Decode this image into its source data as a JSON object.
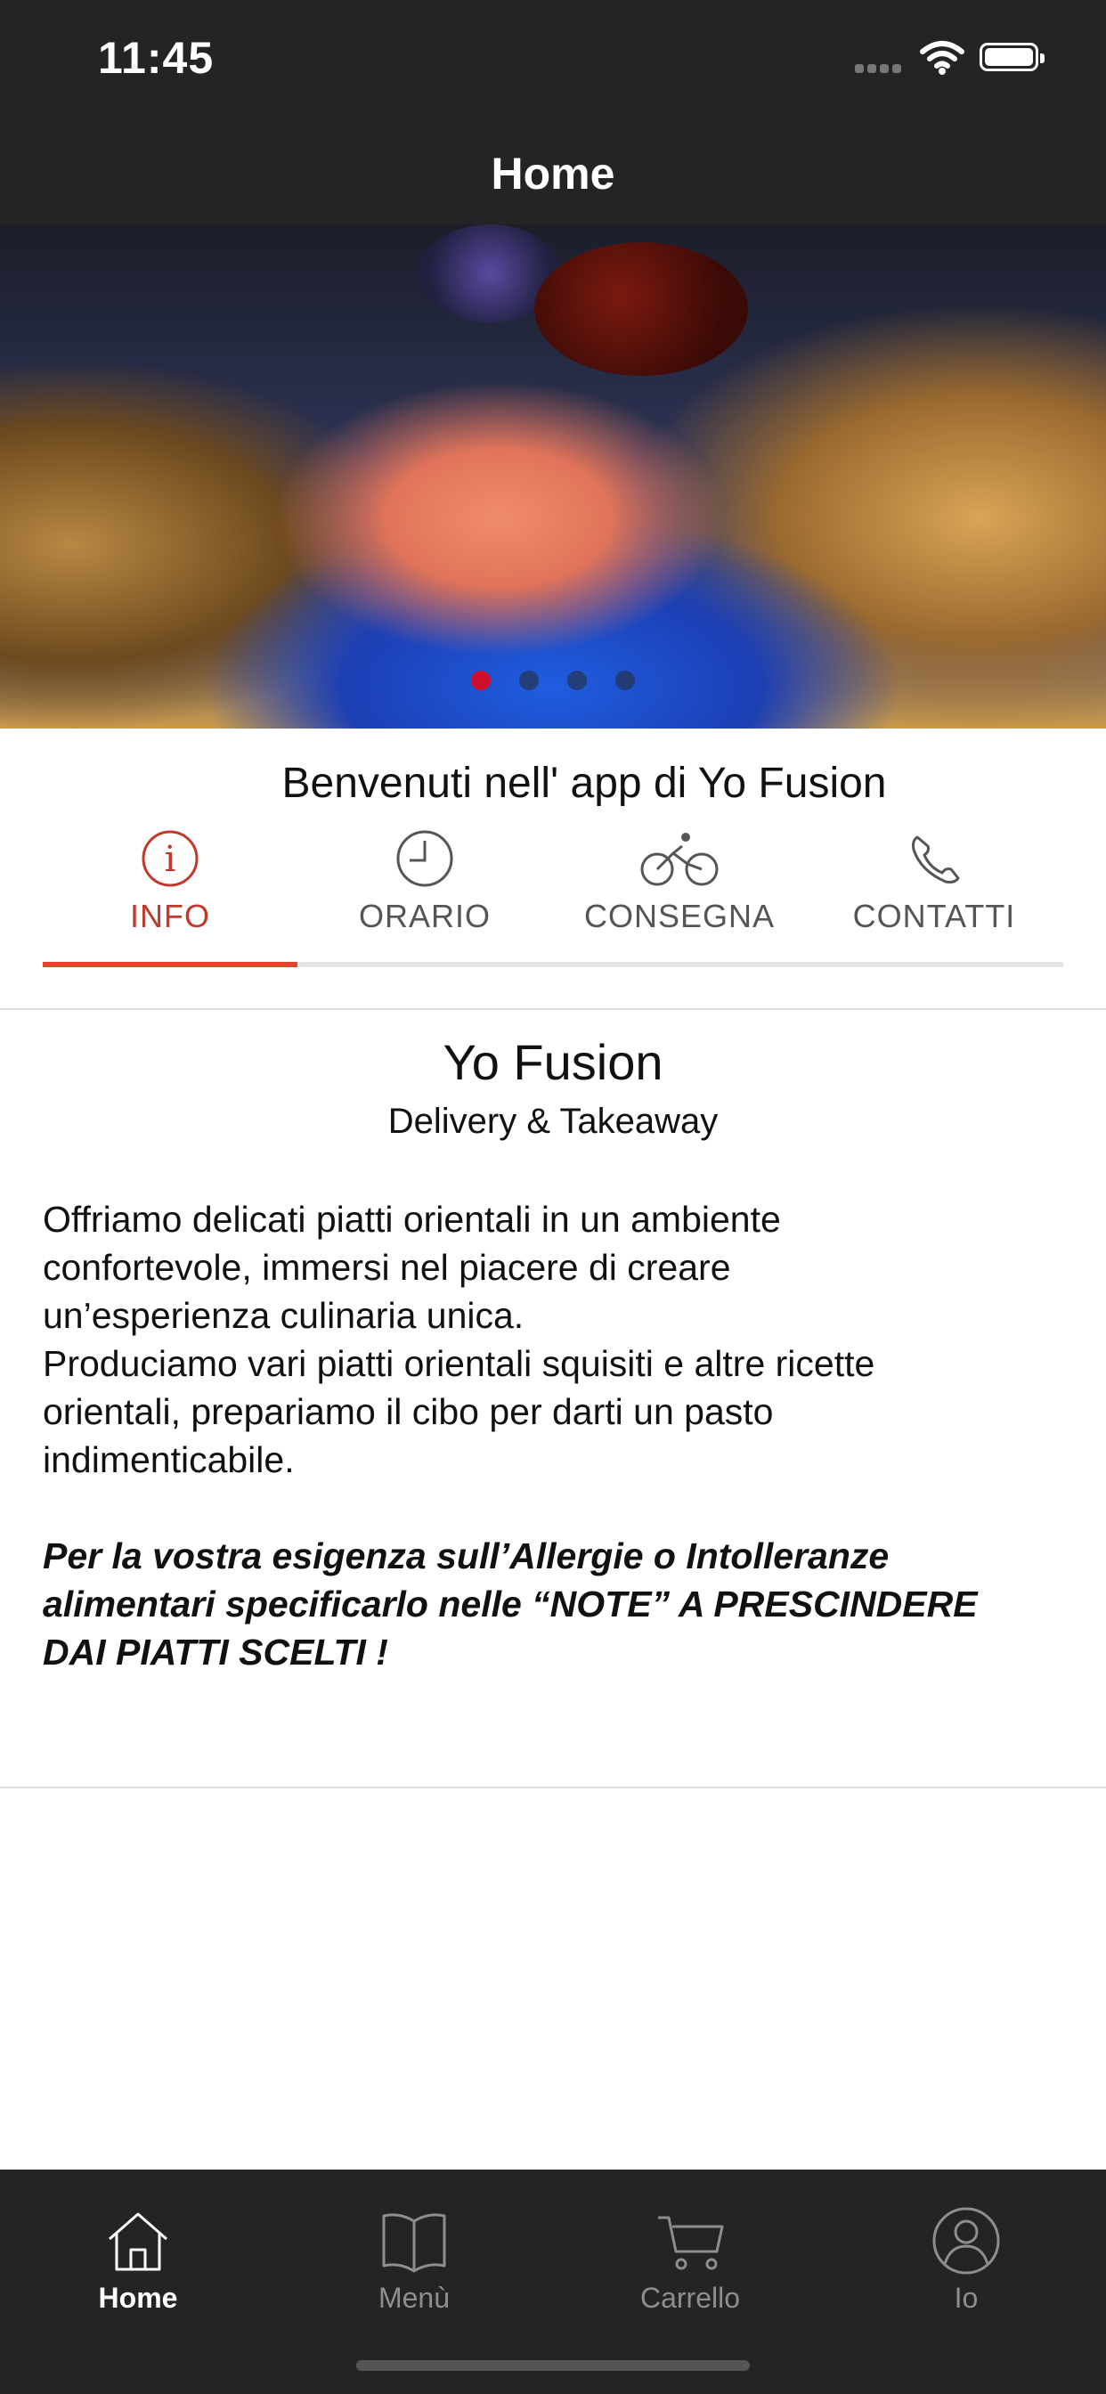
{
  "status_bar": {
    "time": "11:45"
  },
  "nav": {
    "title": "Home"
  },
  "hero": {
    "slides": 4,
    "active_slide": 1
  },
  "welcome": "Benvenuti nell' app di Yo Fusion",
  "tabs": [
    {
      "label": "INFO",
      "icon": "info-icon",
      "active": true
    },
    {
      "label": "ORARIO",
      "icon": "clock-icon",
      "active": false
    },
    {
      "label": "CONSEGNA",
      "icon": "bicycle-icon",
      "active": false
    },
    {
      "label": "CONTATTI",
      "icon": "phone-icon",
      "active": false
    }
  ],
  "info": {
    "title": "Yo Fusion",
    "subtitle": "Delivery & Takeaway",
    "description": "Offriamo delicati piatti orientali in un ambiente\nconfortevole, immersi nel piacere di creare\nun’esperienza culinaria unica.\nProduciamo vari piatti orientali squisiti e altre ricette\norientali, prepariamo il cibo per darti un pasto\nindimenticabile.",
    "allergy_note": "Per la vostra esigenza sull’Allergie o Intolleranze\nalimentari specificarlo nelle “NOTE” A PRESCINDERE\nDAI PIATTI SCELTI !"
  },
  "bottom_nav": [
    {
      "label": "Home",
      "icon": "home-icon",
      "active": true
    },
    {
      "label": "Menù",
      "icon": "book-icon",
      "active": false
    },
    {
      "label": "Carrello",
      "icon": "cart-icon",
      "active": false
    },
    {
      "label": "Io",
      "icon": "user-icon",
      "active": false
    }
  ],
  "colors": {
    "accent": "#d9482f",
    "active_dot": "#d0102a",
    "bar": "#242424"
  }
}
